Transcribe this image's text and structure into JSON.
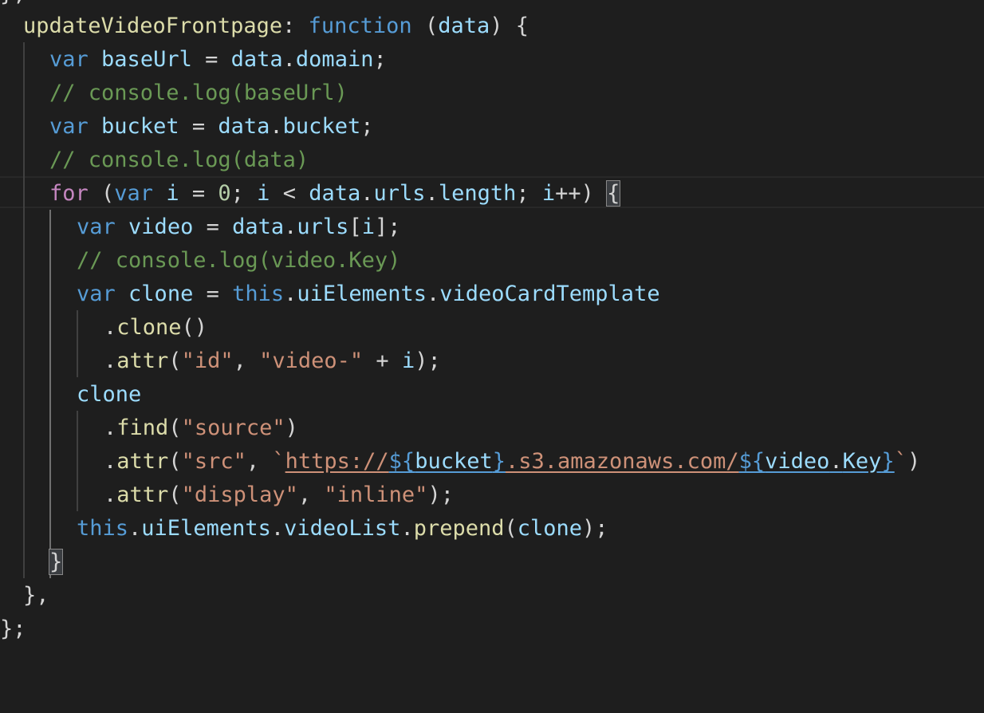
{
  "editor": {
    "theme_colors": {
      "background": "#1e1e1e",
      "keyword": "#569cd6",
      "control": "#c586c0",
      "function": "#dcdcaa",
      "variable": "#9cdcfe",
      "string": "#ce9178",
      "number": "#b5cea8",
      "comment": "#6a9955"
    },
    "partial_top": "};",
    "line1": {
      "name": "updateVideoFrontpage",
      "colon": ":",
      "kw": "function",
      "open": " (",
      "param": "data",
      "close": ") {"
    },
    "line2": {
      "kw": "var",
      "name": "baseUrl",
      "eq": " = ",
      "obj": "data",
      "dot": ".",
      "prop": "domain",
      "semi": ";"
    },
    "line3": {
      "comment": "// console.log(baseUrl)"
    },
    "line4": {
      "kw": "var",
      "name": "bucket",
      "eq": " = ",
      "obj": "data",
      "dot": ".",
      "prop": "bucket",
      "semi": ";"
    },
    "line5": {
      "comment": "// console.log(data)"
    },
    "line6": {
      "kw_for": "for",
      "open": " (",
      "kw_var": "var",
      "i1": "i",
      "eq": " = ",
      "zero": "0",
      "semi1": "; ",
      "i2": "i",
      "lt": " < ",
      "obj": "data",
      "dot1": ".",
      "urls": "urls",
      "dot2": ".",
      "length": "length",
      "semi2": "; ",
      "i3": "i",
      "inc": "++) ",
      "brace": "{"
    },
    "line7": {
      "kw": "var",
      "name": "video",
      "eq": " = ",
      "obj": "data",
      "dot": ".",
      "prop": "urls",
      "open": "[",
      "idx": "i",
      "close": "];"
    },
    "line8": {
      "comment": "// console.log(video.Key)"
    },
    "line9": {
      "kw": "var",
      "name": "clone",
      "eq": " = ",
      "this": "this",
      "dot1": ".",
      "ui": "uiElements",
      "dot2": ".",
      "prop": "videoCardTemplate"
    },
    "line10": {
      "dot": ".",
      "method": "clone",
      "parens": "()"
    },
    "line11": {
      "dot": ".",
      "method": "attr",
      "open": "(",
      "arg1": "\"id\"",
      "comma": ", ",
      "arg2": "\"video-\"",
      "plus": " + ",
      "idx": "i",
      "close": ");"
    },
    "line12": {
      "name": "clone"
    },
    "line13": {
      "dot": ".",
      "method": "find",
      "open": "(",
      "arg": "\"source\"",
      "close": ")"
    },
    "line14": {
      "dot": ".",
      "method": "attr",
      "open": "(",
      "arg1": "\"src\"",
      "comma": ", ",
      "tick1": "`",
      "url1": "https://",
      "d1": "${",
      "v1": "bucket",
      "e1": "}",
      "url2": ".s3.amazonaws.com/",
      "d2": "${",
      "v2": "video",
      "vdot": ".",
      "v3": "Key",
      "e2": "}",
      "tick2": "`",
      "close": ")"
    },
    "line15": {
      "dot": ".",
      "method": "attr",
      "open": "(",
      "arg1": "\"display\"",
      "comma": ", ",
      "arg2": "\"inline\"",
      "close": ");"
    },
    "line16": {
      "this": "this",
      "dot1": ".",
      "ui": "uiElements",
      "dot2": ".",
      "list": "videoList",
      "dot3": ".",
      "method": "prepend",
      "open": "(",
      "arg": "clone",
      "close": ");"
    },
    "line17": {
      "brace": "}"
    },
    "line18": {
      "text": "},"
    },
    "partial_bottom": "};"
  }
}
